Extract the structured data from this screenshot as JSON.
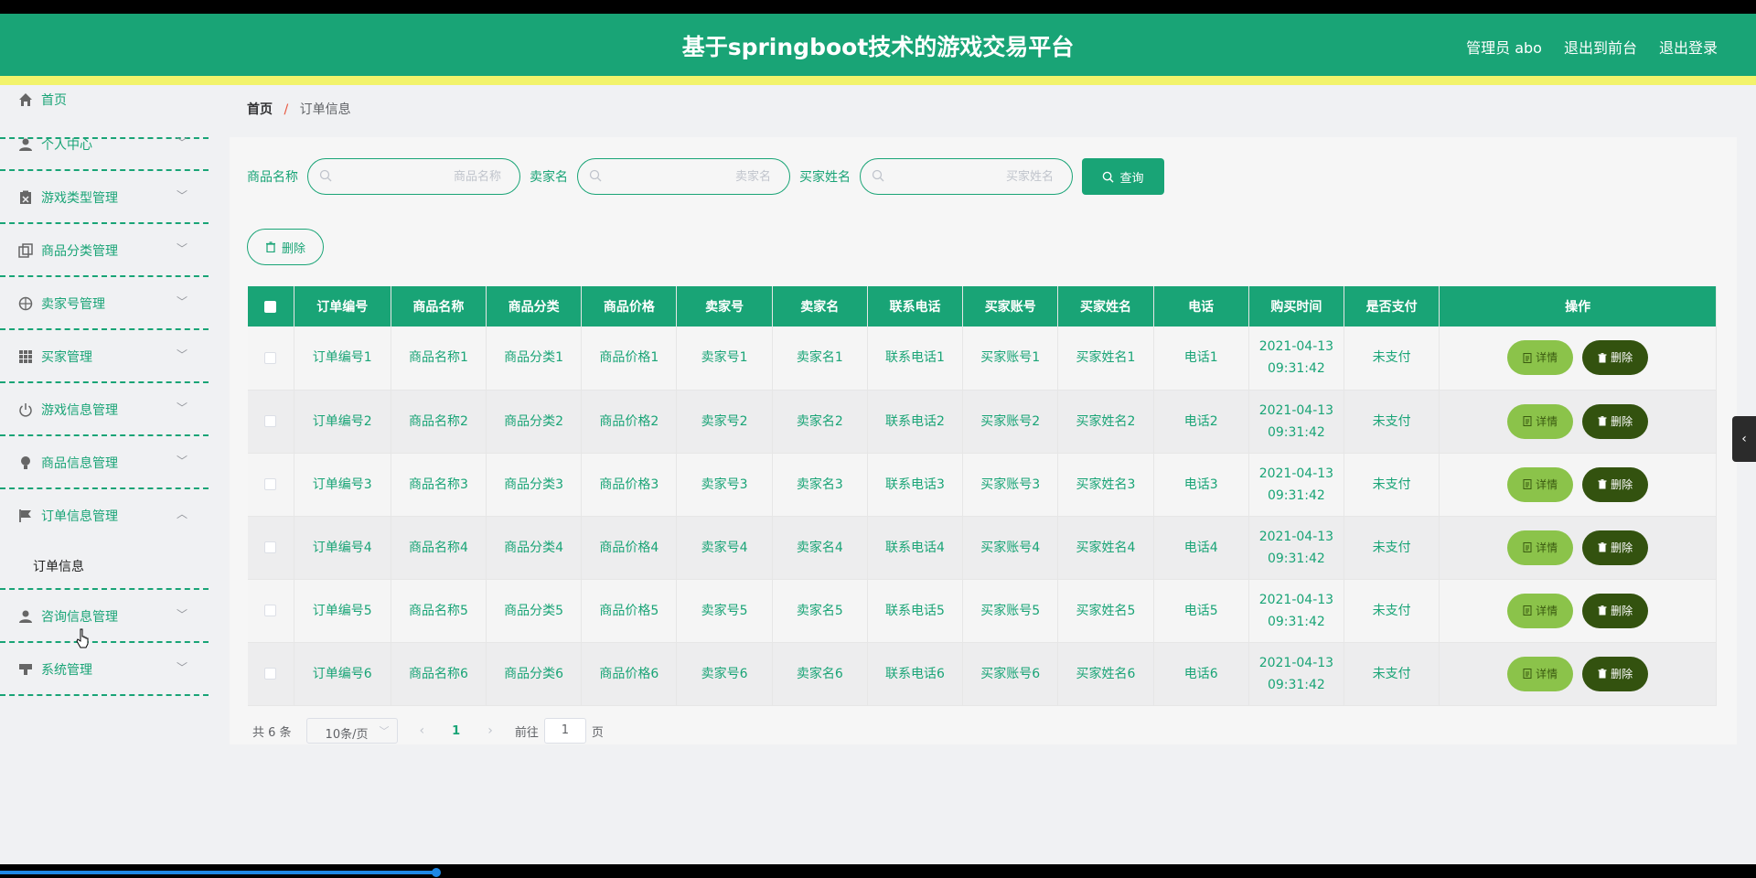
{
  "header": {
    "title": "基于springboot技术的游戏交易平台",
    "user": "管理员 abo",
    "to_front": "退出到前台",
    "logout": "退出登录"
  },
  "sidebar": {
    "items": [
      {
        "label": "首页",
        "icon": "home-icon"
      },
      {
        "label": "个人中心",
        "icon": "user-icon"
      },
      {
        "label": "游戏类型管理",
        "icon": "clipboard-icon"
      },
      {
        "label": "商品分类管理",
        "icon": "copy-icon"
      },
      {
        "label": "卖家号管理",
        "icon": "compass-icon"
      },
      {
        "label": "买家管理",
        "icon": "grid-icon"
      },
      {
        "label": "游戏信息管理",
        "icon": "power-icon"
      },
      {
        "label": "商品信息管理",
        "icon": "bulb-icon"
      },
      {
        "label": "订单信息管理",
        "icon": "flag-icon"
      },
      {
        "label": "咨询信息管理",
        "icon": "user-icon"
      },
      {
        "label": "系统管理",
        "icon": "stamp-icon"
      }
    ],
    "sub_item": "订单信息"
  },
  "breadcrumb": {
    "home": "首页",
    "sep": "/",
    "current": "订单信息"
  },
  "search": {
    "product_label": "商品名称",
    "product_placeholder": "商品名称",
    "seller_label": "卖家名",
    "seller_placeholder": "卖家名",
    "buyer_label": "买家姓名",
    "buyer_placeholder": "买家姓名",
    "query_label": "查询"
  },
  "toolbar": {
    "delete_label": "删除"
  },
  "table": {
    "headers": [
      "订单编号",
      "商品名称",
      "商品分类",
      "商品价格",
      "卖家号",
      "卖家名",
      "联系电话",
      "买家账号",
      "买家姓名",
      "电话",
      "购买时间",
      "是否支付",
      "操作"
    ],
    "rows": [
      [
        "订单编号1",
        "商品名称1",
        "商品分类1",
        "商品价格1",
        "卖家号1",
        "卖家名1",
        "联系电话1",
        "买家账号1",
        "买家姓名1",
        "电话1",
        "2021-04-13",
        "09:31:42",
        "未支付"
      ],
      [
        "订单编号2",
        "商品名称2",
        "商品分类2",
        "商品价格2",
        "卖家号2",
        "卖家名2",
        "联系电话2",
        "买家账号2",
        "买家姓名2",
        "电话2",
        "2021-04-13",
        "09:31:42",
        "未支付"
      ],
      [
        "订单编号3",
        "商品名称3",
        "商品分类3",
        "商品价格3",
        "卖家号3",
        "卖家名3",
        "联系电话3",
        "买家账号3",
        "买家姓名3",
        "电话3",
        "2021-04-13",
        "09:31:42",
        "未支付"
      ],
      [
        "订单编号4",
        "商品名称4",
        "商品分类4",
        "商品价格4",
        "卖家号4",
        "卖家名4",
        "联系电话4",
        "买家账号4",
        "买家姓名4",
        "电话4",
        "2021-04-13",
        "09:31:42",
        "未支付"
      ],
      [
        "订单编号5",
        "商品名称5",
        "商品分类5",
        "商品价格5",
        "卖家号5",
        "卖家名5",
        "联系电话5",
        "买家账号5",
        "买家姓名5",
        "电话5",
        "2021-04-13",
        "09:31:42",
        "未支付"
      ],
      [
        "订单编号6",
        "商品名称6",
        "商品分类6",
        "商品价格6",
        "卖家号6",
        "卖家名6",
        "联系电话6",
        "买家账号6",
        "买家姓名6",
        "电话6",
        "2021-04-13",
        "09:31:42",
        "未支付"
      ]
    ],
    "detail_label": "详情",
    "delete_label": "删除"
  },
  "pagination": {
    "total": "共 6 条",
    "page_size": "10条/页",
    "current_page": "1",
    "goto_label": "前往",
    "goto_value": "1",
    "page_suffix": "页"
  },
  "colors": {
    "primary": "#19a476",
    "stripe": "#f2f36b",
    "detail_btn": "#8bc34a",
    "delete_btn": "#33520f"
  }
}
